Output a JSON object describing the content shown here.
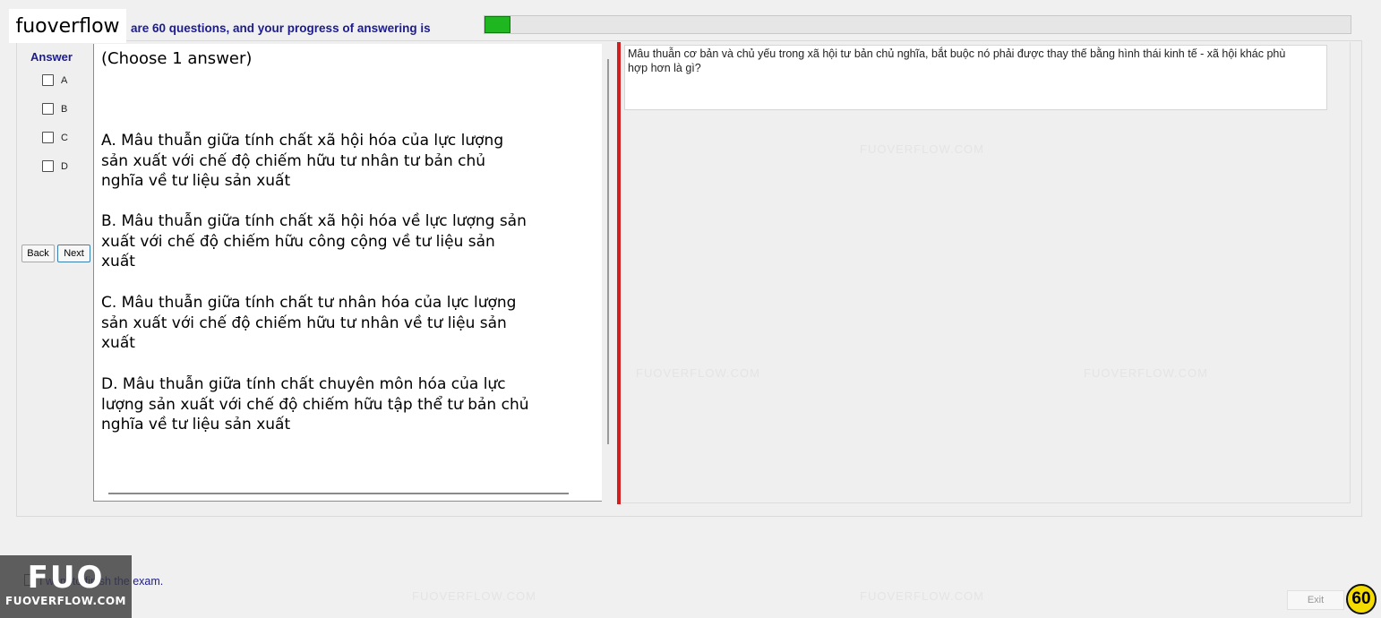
{
  "brand_label": "fuoverflow",
  "progress": {
    "text": "are 60 questions, and your progress of answering is",
    "fraction": 0.03,
    "color": "#1fb71f"
  },
  "answer_panel": {
    "title": "Answer",
    "options": [
      "A",
      "B",
      "C",
      "D"
    ]
  },
  "nav": {
    "back_label": "Back",
    "next_label": "Next"
  },
  "content": {
    "choose_note": "(Choose 1 answer)",
    "options": [
      "A.  Mâu thuẫn giữa tính chất xã hội hóa của lực lượng sản xuất với chế độ chiếm hữu tư nhân tư bản chủ nghĩa về tư liệu sản xuất",
      "B.  Mâu thuẫn giữa tính chất xã hội hóa về lực lượng sản xuất với chế độ chiếm hữu công cộng về tư liệu sản xuất",
      "C.  Mâu thuẫn giữa tính chất tư nhân hóa của lực lượng sản xuất với chế độ chiếm hữu tư nhân về tư liệu sản xuất",
      "D.  Mâu thuẫn giữa tính chất chuyên môn hóa của lực lượng sản xuất với chế độ chiếm hữu tập thể tư bản chủ nghĩa về tư liệu sản xuất"
    ]
  },
  "question": {
    "text": "Mâu thuẫn cơ bản và chủ yếu trong xã hội tư bản chủ nghĩa, bắt buộc nó phải được thay thế bằng hình thái kinh tế - xã hội khác phù hợp hơn là gì?"
  },
  "watermark": "FUOVERFLOW.COM",
  "finish": {
    "label": "I want to finish the exam."
  },
  "logo": {
    "big": "FUO",
    "small": "FUOVERFLOW.COM"
  },
  "exit_label": "Exit",
  "counter": "60",
  "colors": {
    "splitter": "#d21e1e",
    "counter_bg": "#f5dc00",
    "heading": "#1c1c8c"
  }
}
